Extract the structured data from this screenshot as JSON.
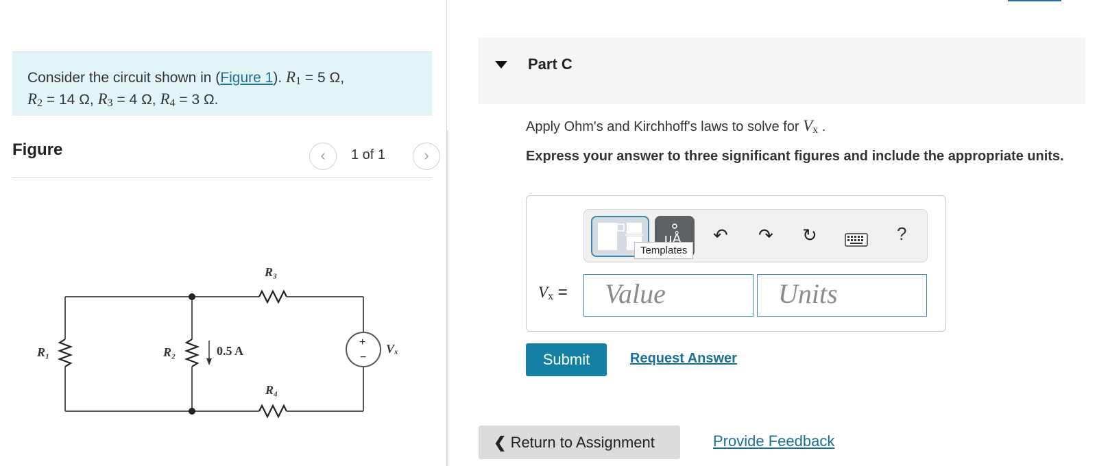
{
  "problem": {
    "intro": "Consider the circuit shown in (",
    "figure_link": "Figure 1",
    "after_link": ").",
    "r1_var": "R",
    "r1_sub": "1",
    "r1_val": " = 5 Ω,",
    "r2_var": "R",
    "r2_sub": "2",
    "r2_val": " = 14 Ω, ",
    "r3_var": "R",
    "r3_sub": "3",
    "r3_val": " = 4 Ω, ",
    "r4_var": "R",
    "r4_sub": "4",
    "r4_val": " = 3 Ω."
  },
  "figure": {
    "label": "Figure",
    "pager": "1 of 1",
    "prev_icon": "chevron-left-icon",
    "next_icon": "chevron-right-icon",
    "circuit": {
      "r1": "R₁",
      "r2": "R₂",
      "r3": "R₃",
      "r4": "R₄",
      "current": "0.5 A",
      "vx": "Vₓ",
      "plus": "+",
      "minus": "−"
    }
  },
  "part": {
    "title": "Part C",
    "instruction_text": "Apply Ohm's and Kirchhoff's laws to solve for ",
    "instruction_var": "V",
    "instruction_sub": "x",
    "instruction_end": " .",
    "express": "Express your answer to three significant figures and include the appropriate units."
  },
  "answer": {
    "toolbar": {
      "templates_tooltip": "Templates",
      "undo_icon": "undo-icon",
      "redo_icon": "redo-icon",
      "reset_icon": "reset-icon",
      "keyboard_icon": "keyboard-icon",
      "help_label": "?"
    },
    "var_label": "V",
    "var_sub": "x",
    "var_eq": " =",
    "value_placeholder": "Value",
    "units_placeholder": "Units"
  },
  "actions": {
    "submit": "Submit",
    "request": "Request Answer",
    "return_label": "Return to Assignment",
    "return_icon": "chevron-left-icon",
    "feedback": "Provide Feedback"
  }
}
